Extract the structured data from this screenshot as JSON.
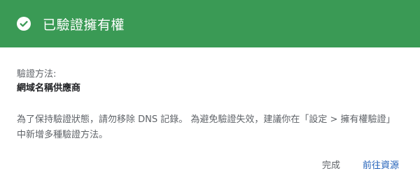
{
  "header": {
    "icon": "check-circle-icon",
    "title": "已驗證擁有權",
    "background_color": "#3a9a55"
  },
  "verification": {
    "method_label": "驗證方法:",
    "method_value": "網域名稱供應商"
  },
  "notice": {
    "text": "為了保持驗證狀態，請勿移除 DNS 記錄。 為避免驗證失效，建議你在「設定 > 擁有權驗證」中新增多種驗證方法。"
  },
  "actions": {
    "done_label": "完成",
    "go_label": "前往資源"
  }
}
